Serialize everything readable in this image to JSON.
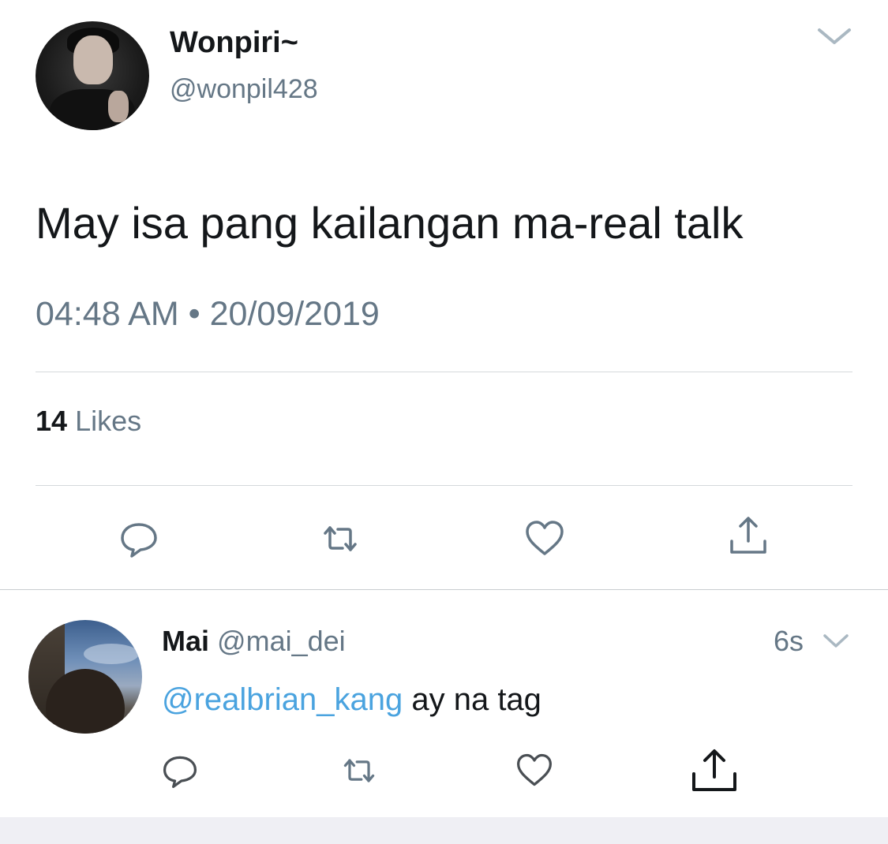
{
  "tweet": {
    "display_name": "Wonpiri~",
    "handle": "@wonpil428",
    "text": "May isa pang kailangan ma-real talk",
    "timestamp": "04:48 AM • 20/09/2019",
    "likes_count": "14",
    "likes_label": "Likes"
  },
  "reply": {
    "display_name": "Mai",
    "handle": "@mai_dei",
    "time": "6s",
    "mention": "@realbrian_kang",
    "text": " ay na tag"
  },
  "icons": {
    "menu": "chevron-down-icon",
    "reply": "speech-bubble-icon",
    "retweet": "retweet-icon",
    "like": "heart-icon",
    "share": "share-icon"
  },
  "colors": {
    "text_primary": "#14171a",
    "text_secondary": "#657786",
    "mention": "#4aa3df",
    "divider": "#d5d9dc"
  }
}
